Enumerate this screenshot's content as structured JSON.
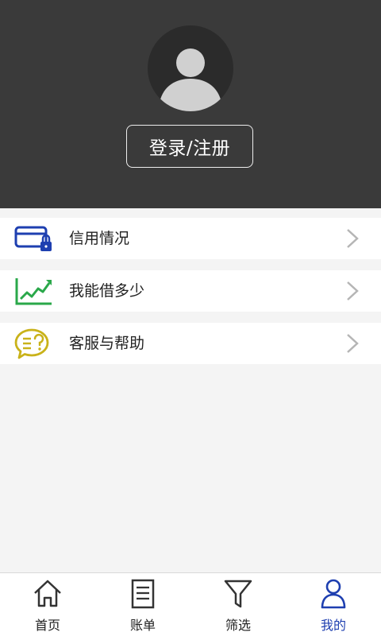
{
  "profile": {
    "login_label": "登录/注册"
  },
  "menu": {
    "items": [
      {
        "label": "信用情况",
        "icon": "credit-card-lock-icon"
      },
      {
        "label": "我能借多少",
        "icon": "growth-chart-icon"
      },
      {
        "label": "客服与帮助",
        "icon": "help-chat-icon"
      }
    ]
  },
  "tabbar": {
    "items": [
      {
        "label": "首页",
        "icon": "home-icon"
      },
      {
        "label": "账单",
        "icon": "bill-icon"
      },
      {
        "label": "筛选",
        "icon": "filter-icon"
      },
      {
        "label": "我的",
        "icon": "user-icon",
        "active": true
      }
    ]
  },
  "colors": {
    "header_bg": "#3a3a3a",
    "accent_blue": "#1e3fb0",
    "chart_green": "#2aa84a",
    "help_yellow": "#c9b21a"
  }
}
